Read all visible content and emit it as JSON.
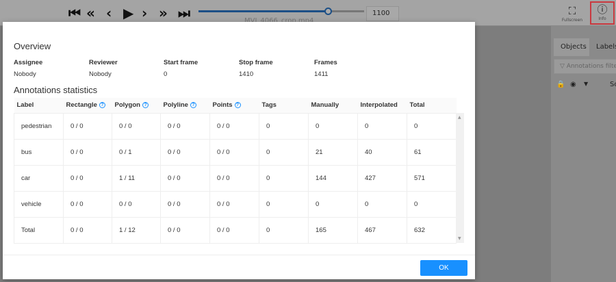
{
  "player": {
    "frame": "1100",
    "filename": "MVI_4066_crop.mp4",
    "progress_fraction": 0.78
  },
  "toolbar": {
    "fullscreen": "Fullscreen",
    "info": "Info"
  },
  "side": {
    "tab_objects": "Objects",
    "tab_labels": "Labels",
    "filter_placeholder": "Annotations filter",
    "sort": "So"
  },
  "modal": {
    "overview_title": "Overview",
    "overview": [
      {
        "k": "Assignee",
        "v": "Nobody"
      },
      {
        "k": "Reviewer",
        "v": "Nobody"
      },
      {
        "k": "Start frame",
        "v": "0"
      },
      {
        "k": "Stop frame",
        "v": "1410"
      },
      {
        "k": "Frames",
        "v": "1411"
      }
    ],
    "stats_title": "Annotations statistics",
    "columns": [
      "Label",
      "Rectangle",
      "Polygon",
      "Polyline",
      "Points",
      "Tags",
      "Manually",
      "Interpolated",
      "Total"
    ],
    "rows": [
      [
        "pedestrian",
        "0 / 0",
        "0 / 0",
        "0 / 0",
        "0 / 0",
        "0",
        "0",
        "0",
        "0"
      ],
      [
        "bus",
        "0 / 0",
        "0 / 1",
        "0 / 0",
        "0 / 0",
        "0",
        "21",
        "40",
        "61"
      ],
      [
        "car",
        "0 / 0",
        "1 / 11",
        "0 / 0",
        "0 / 0",
        "0",
        "144",
        "427",
        "571"
      ],
      [
        "vehicle",
        "0 / 0",
        "0 / 0",
        "0 / 0",
        "0 / 0",
        "0",
        "0",
        "0",
        "0"
      ],
      [
        "Total",
        "0 / 0",
        "1 / 12",
        "0 / 0",
        "0 / 0",
        "0",
        "165",
        "467",
        "632"
      ]
    ],
    "ok": "OK"
  }
}
